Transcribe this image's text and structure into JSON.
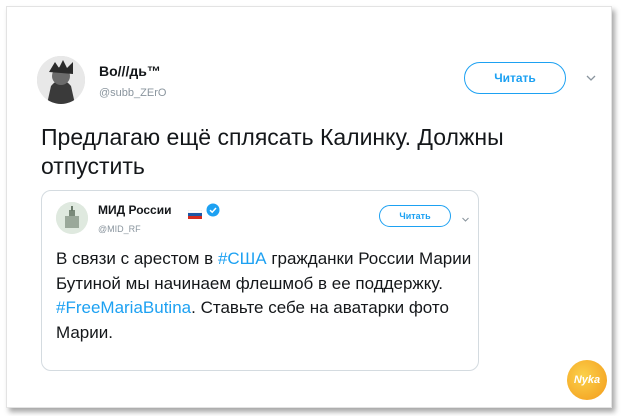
{
  "tweet": {
    "display_name": "Bo///дь™",
    "handle": "@subb_ZErO",
    "follow_label": "Читать",
    "text": "Предлагаю ещё сплясать Калинку. Должны отпустить"
  },
  "quoted_tweet": {
    "display_name": "МИД России",
    "handle": "@MID_RF",
    "follow_label": "Читать",
    "text_parts": {
      "p1": "В связи с арестом в ",
      "hashtag1": "#США",
      "p2": " гражданки России Марии Бутиной мы начинаем флешмоб в ее поддержку. ",
      "hashtag2": "#FreeMariaButina",
      "p3": ". Ставьте себе на аватарки фото Марии."
    }
  },
  "watermark": {
    "text": "Nyka"
  },
  "colors": {
    "accent": "#1da1f2",
    "text": "#14171a",
    "muted": "#8a959e",
    "verified": "#1da1f2"
  }
}
